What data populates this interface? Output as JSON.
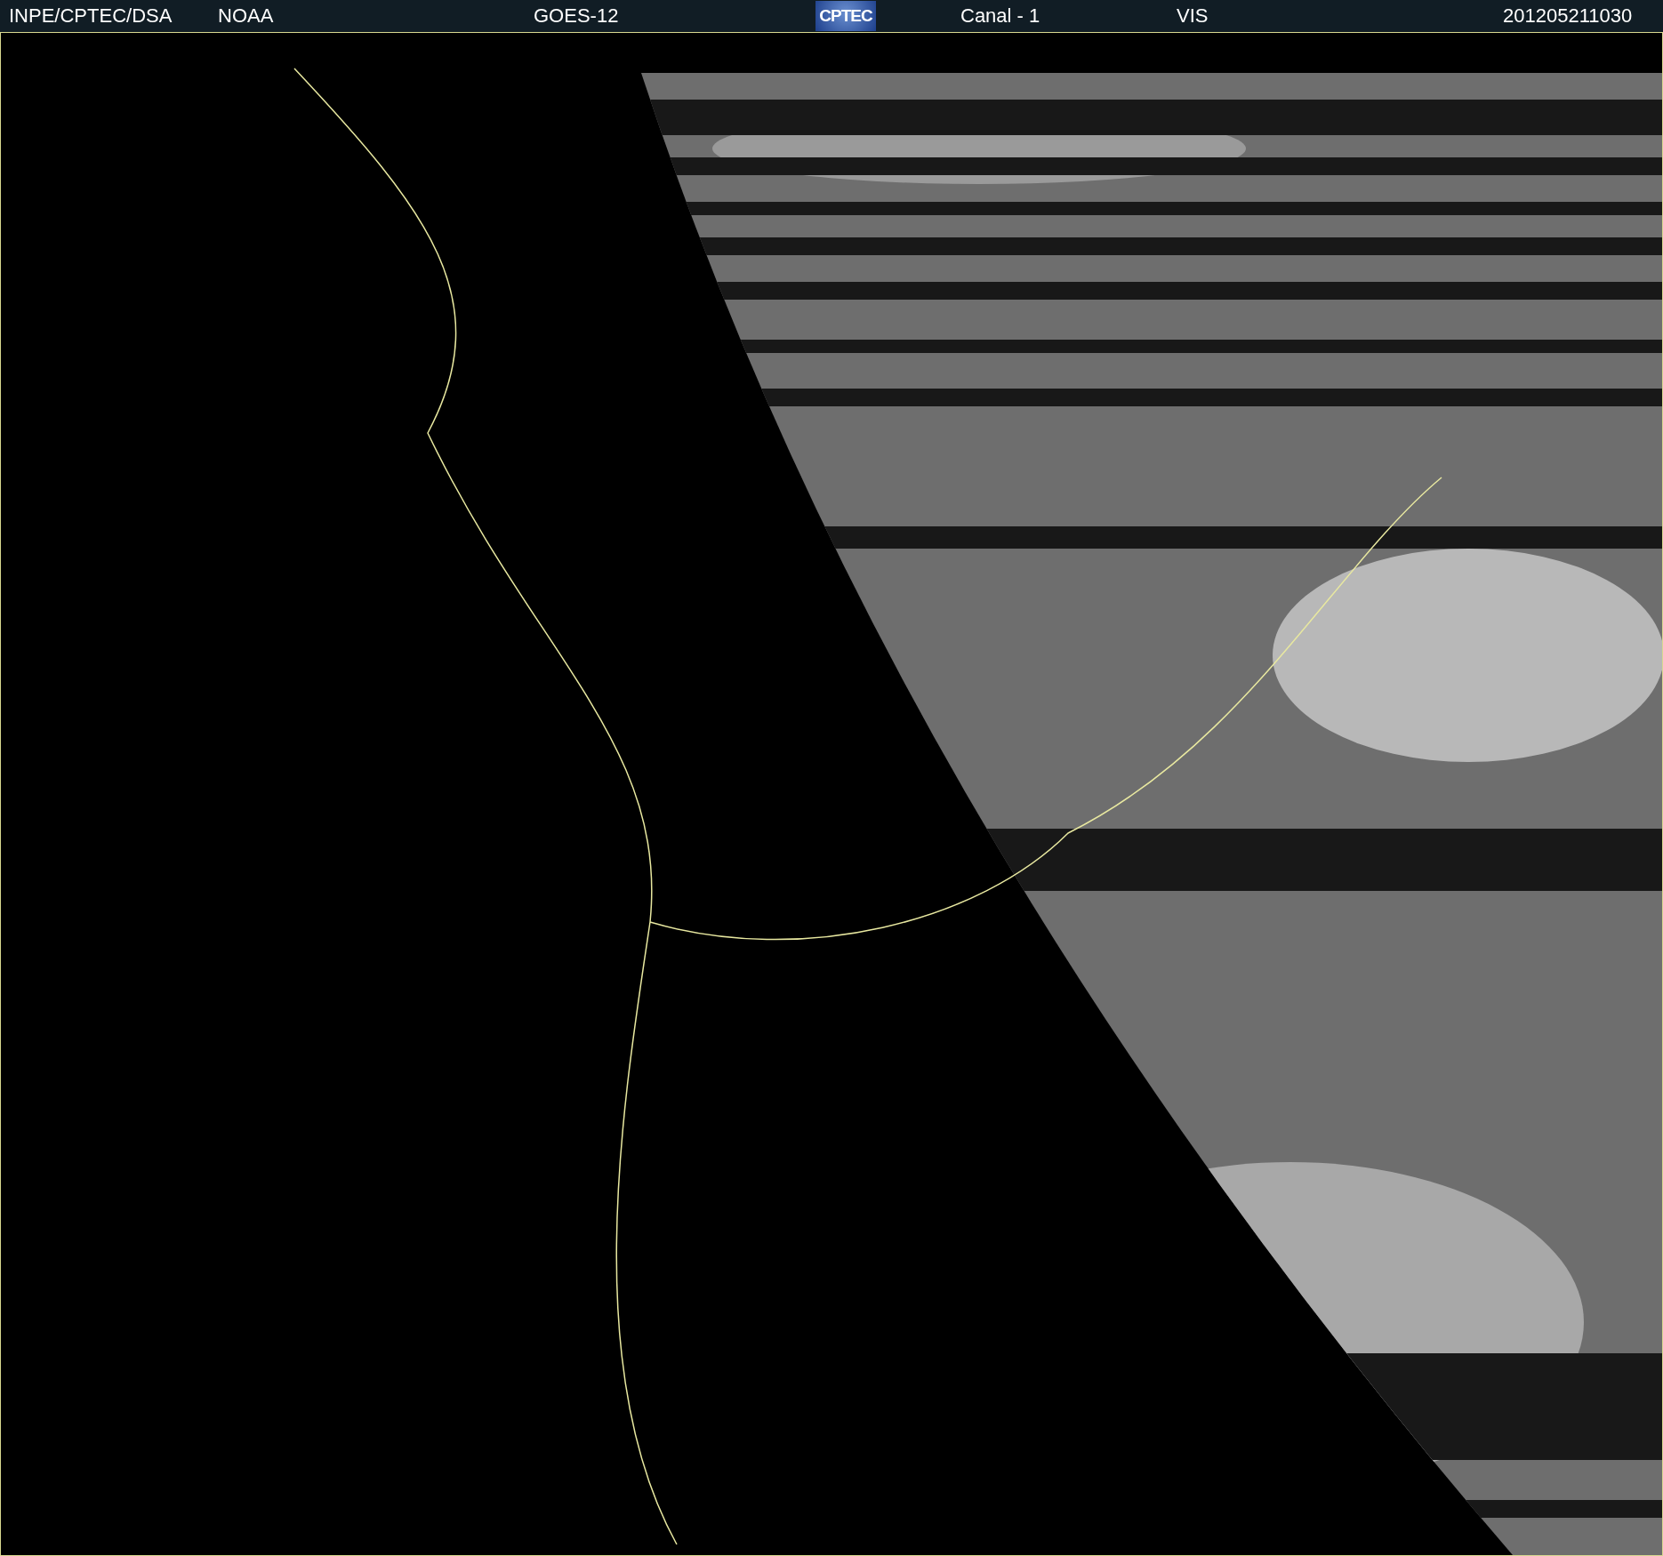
{
  "header": {
    "source": "INPE/CPTEC/DSA",
    "agency": "NOAA",
    "satellite": "GOES-12",
    "logo": "CPTEC",
    "channel": "Canal - 1",
    "band": "VIS",
    "timestamp": "201205211030"
  }
}
